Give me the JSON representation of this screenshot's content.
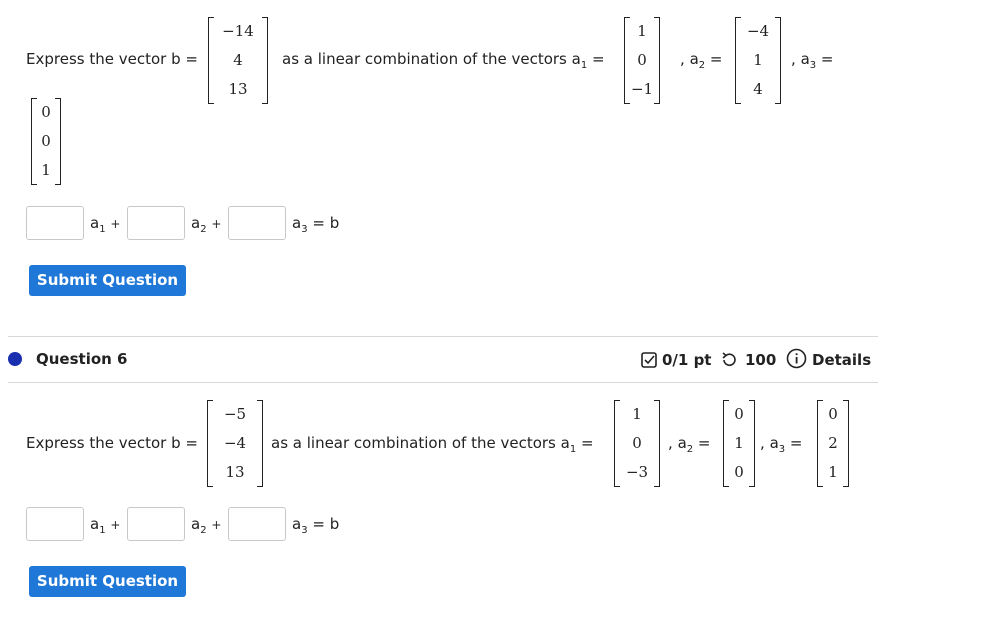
{
  "q5": {
    "prompt_lead": "Express the vector b =",
    "prompt_mid": "as a linear combination of the vectors",
    "b": [
      "−14",
      "4",
      "13"
    ],
    "a1": [
      "1",
      "0",
      "−1"
    ],
    "a2": [
      "−4",
      "1",
      "4"
    ],
    "a3": [
      "0",
      "0",
      "1"
    ],
    "a1_label": "a",
    "a2_label": "a",
    "a3_label": "a",
    "sub1": "1",
    "sub2": "2",
    "sub3": "3",
    "eq": "=",
    "comma": ",",
    "plus": "+",
    "tail": "= b",
    "submit_label": "Submit Question"
  },
  "q6": {
    "title": "Question 6",
    "score": "0/1 pt",
    "attempts": "100",
    "details": "Details",
    "prompt_lead": "Express the vector b =",
    "prompt_mid": "as a linear combination of the vectors",
    "b": [
      "−5",
      "−4",
      "13"
    ],
    "a1": [
      "1",
      "0",
      "−3"
    ],
    "a2": [
      "0",
      "1",
      "0"
    ],
    "a3": [
      "0",
      "2",
      "1"
    ],
    "a_label": "a",
    "sub1": "1",
    "sub2": "2",
    "sub3": "3",
    "eq": "=",
    "comma": ",",
    "plus": "+",
    "tail": "= b",
    "submit_label": "Submit Question"
  }
}
